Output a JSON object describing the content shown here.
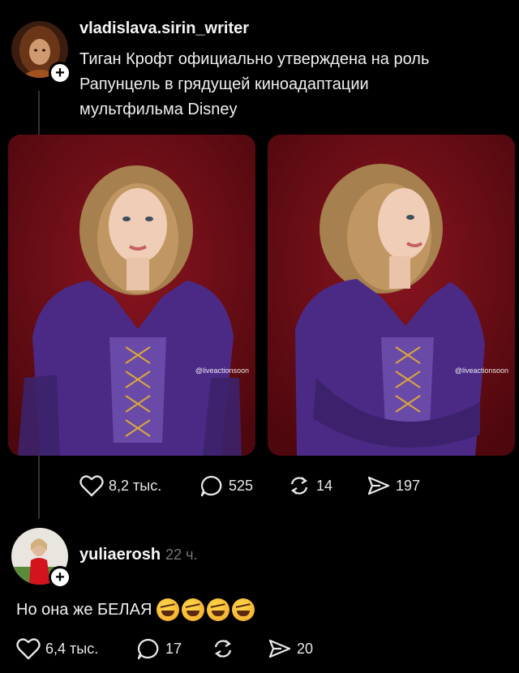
{
  "post": {
    "username": "vladislava.sirin_writer",
    "text_line1": "Тиган Крофт официально утверждена на роль",
    "text_line2": "Рапунцель в грядущей  киноадаптации",
    "text_line3": "мультфильма Disney",
    "watermark": "@liveactionsoon",
    "likes": "8,2 тыс.",
    "comments": "525",
    "reposts": "14",
    "shares": "197"
  },
  "reply": {
    "username": "yuliaerosh",
    "time": "22 ч.",
    "text": "Но она же БЕЛАЯ",
    "emoji": [
      "rofl-emoji",
      "rofl-emoji",
      "rofl-emoji",
      "rofl-emoji"
    ],
    "likes": "6,4 тыс.",
    "comments": "17",
    "shares": "20"
  },
  "colors": {
    "background": "#000000",
    "text": "#f0f0f0",
    "muted": "#777777",
    "photo_background": "#6e0c14",
    "dress": "#4b2a86",
    "hair": "#b68a56"
  }
}
